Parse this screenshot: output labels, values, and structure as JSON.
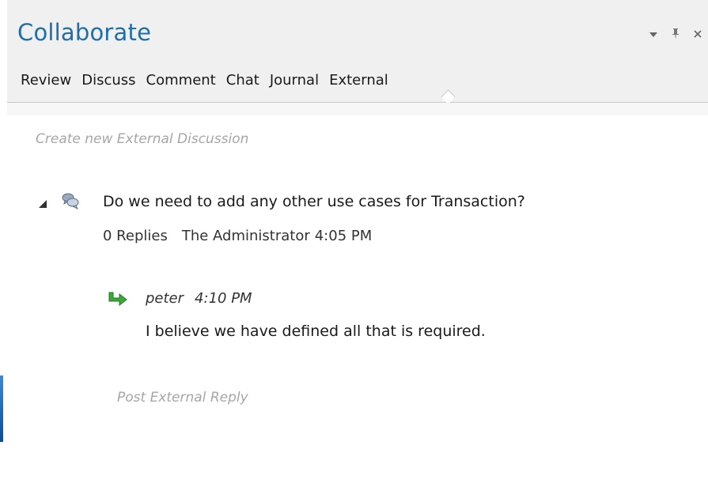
{
  "window": {
    "title": "Collaborate",
    "icons": [
      "dropdown-arrow-icon",
      "pin-icon",
      "close-icon"
    ]
  },
  "tabs": [
    {
      "label": "Review"
    },
    {
      "label": "Discuss"
    },
    {
      "label": "Comment"
    },
    {
      "label": "Chat"
    },
    {
      "label": "Journal"
    },
    {
      "label": "External",
      "active": true
    }
  ],
  "create_placeholder": "Create new External Discussion",
  "thread": {
    "question": "Do we need to add any other use cases for Transaction?",
    "replies_count": "0 Replies",
    "author": "The Administrator",
    "time": "4:05 PM",
    "icon": "discussion-icon"
  },
  "reply": {
    "author": "peter",
    "time": "4:10 PM",
    "text": "I believe we have defined all that is required.",
    "icon": "reply-arrow-icon"
  },
  "post_reply_placeholder": "Post External Reply",
  "colors": {
    "title": "#1f6ea8",
    "reply_icon": "#3aa83a",
    "accent": "#1a6fc4"
  }
}
